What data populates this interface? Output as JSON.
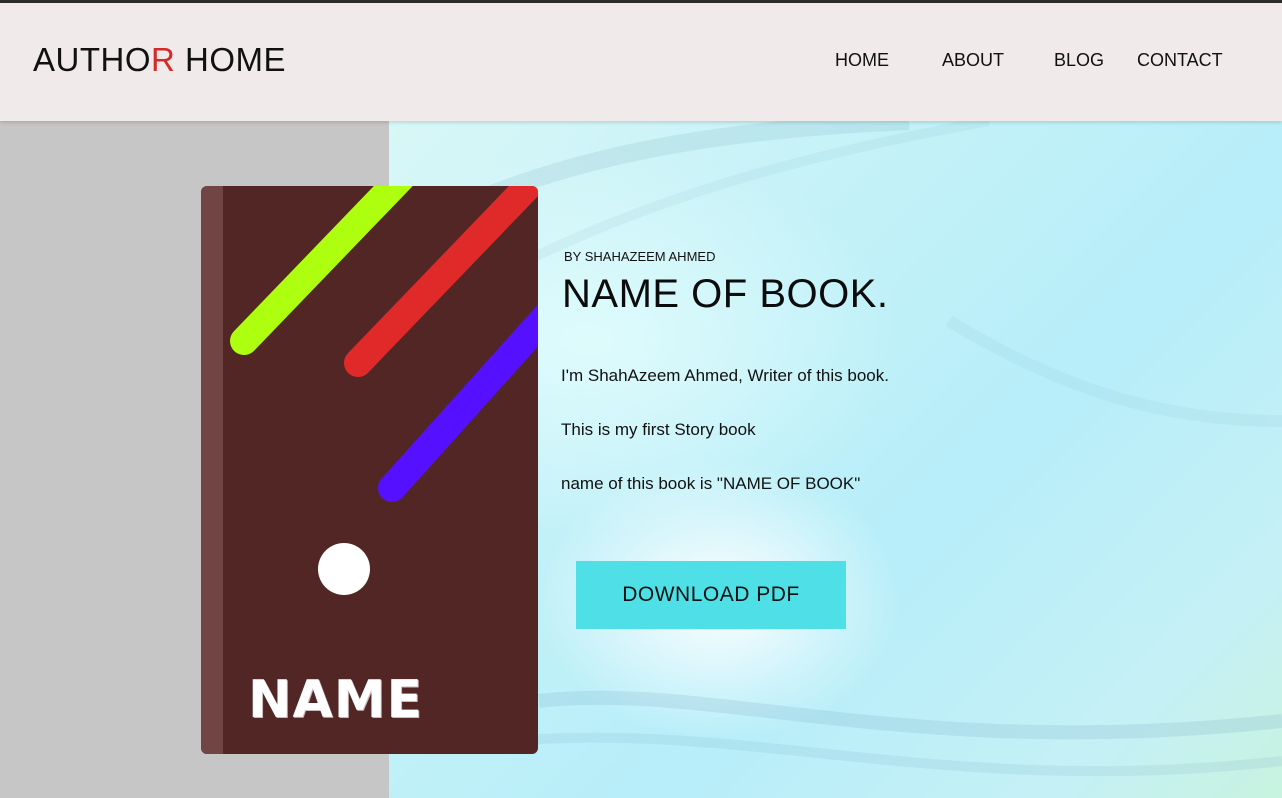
{
  "header": {
    "logo_part1": "AUTHO",
    "logo_accent": "R",
    "logo_part2": " HOME",
    "nav": [
      "HOME",
      "ABOUT",
      "BLOG",
      "CONTACT"
    ]
  },
  "book": {
    "cover_text": "NAME",
    "stripe_colors": [
      "#adff0f",
      "#e02a2a",
      "#5511ff"
    ],
    "cover_color": "#532626"
  },
  "content": {
    "by_line": "BY SHAHAZEEM AHMED",
    "title": "NAME OF BOOK.",
    "paragraphs": [
      "I'm ShahAzeem Ahmed, Writer of this book.",
      "This is my first Story book",
      "name of this book is \"NAME OF BOOK\""
    ],
    "download_label": "DOWNLOAD PDF"
  },
  "colors": {
    "logo_accent": "#d42a2a",
    "button": "#4ee0e6",
    "header_bg": "#f1eaea"
  }
}
